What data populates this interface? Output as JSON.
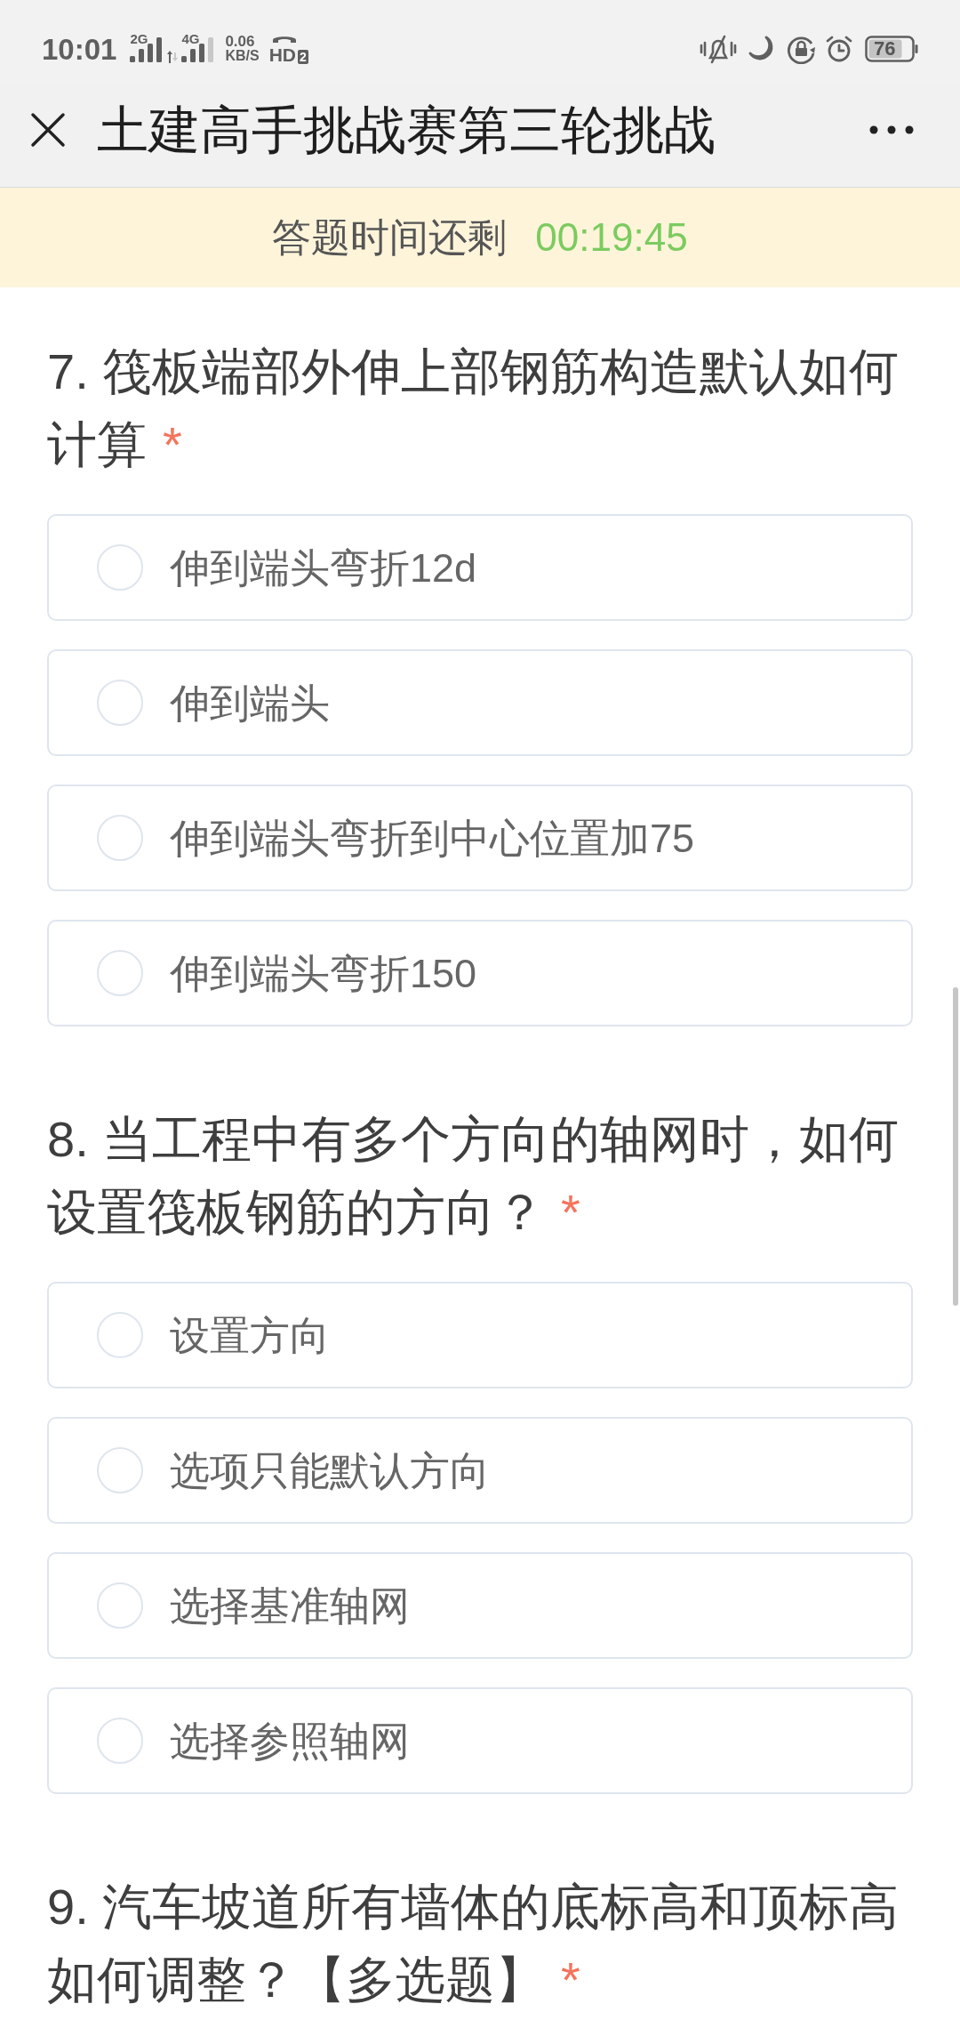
{
  "status_bar": {
    "time": "10:01",
    "sim_1": "2G",
    "sim_2": "4G",
    "speed_value": "0.06",
    "speed_unit": "KB/S",
    "hd": "HD",
    "hd_sim": "2",
    "battery": "76"
  },
  "header": {
    "title": "土建高手挑战赛第三轮挑战"
  },
  "timer": {
    "label": "答题时间还剩",
    "time": "00:19:45"
  },
  "questions": [
    {
      "title": "7. 筏板端部外伸上部钢筋构造默认如何计算",
      "required_mark": "*",
      "options": [
        {
          "label": "伸到端头弯折12d",
          "selected": false
        },
        {
          "label": "伸到端头",
          "selected": false
        },
        {
          "label": "伸到端头弯折到中心位置加75",
          "selected": false
        },
        {
          "label": "伸到端头弯折150",
          "selected": false
        }
      ]
    },
    {
      "title": "8. 当工程中有多个方向的轴网时，如何设置筏板钢筋的方向？",
      "required_mark": "*",
      "options": [
        {
          "label": "设置方向",
          "selected": false
        },
        {
          "label": "选项只能默认方向",
          "selected": false
        },
        {
          "label": "选择基准轴网",
          "selected": false
        },
        {
          "label": "选择参照轴网",
          "selected": false
        }
      ]
    },
    {
      "title": "9. 汽车坡道所有墙体的底标高和顶标高如何调整？【多选题】",
      "required_mark": "*"
    }
  ]
}
